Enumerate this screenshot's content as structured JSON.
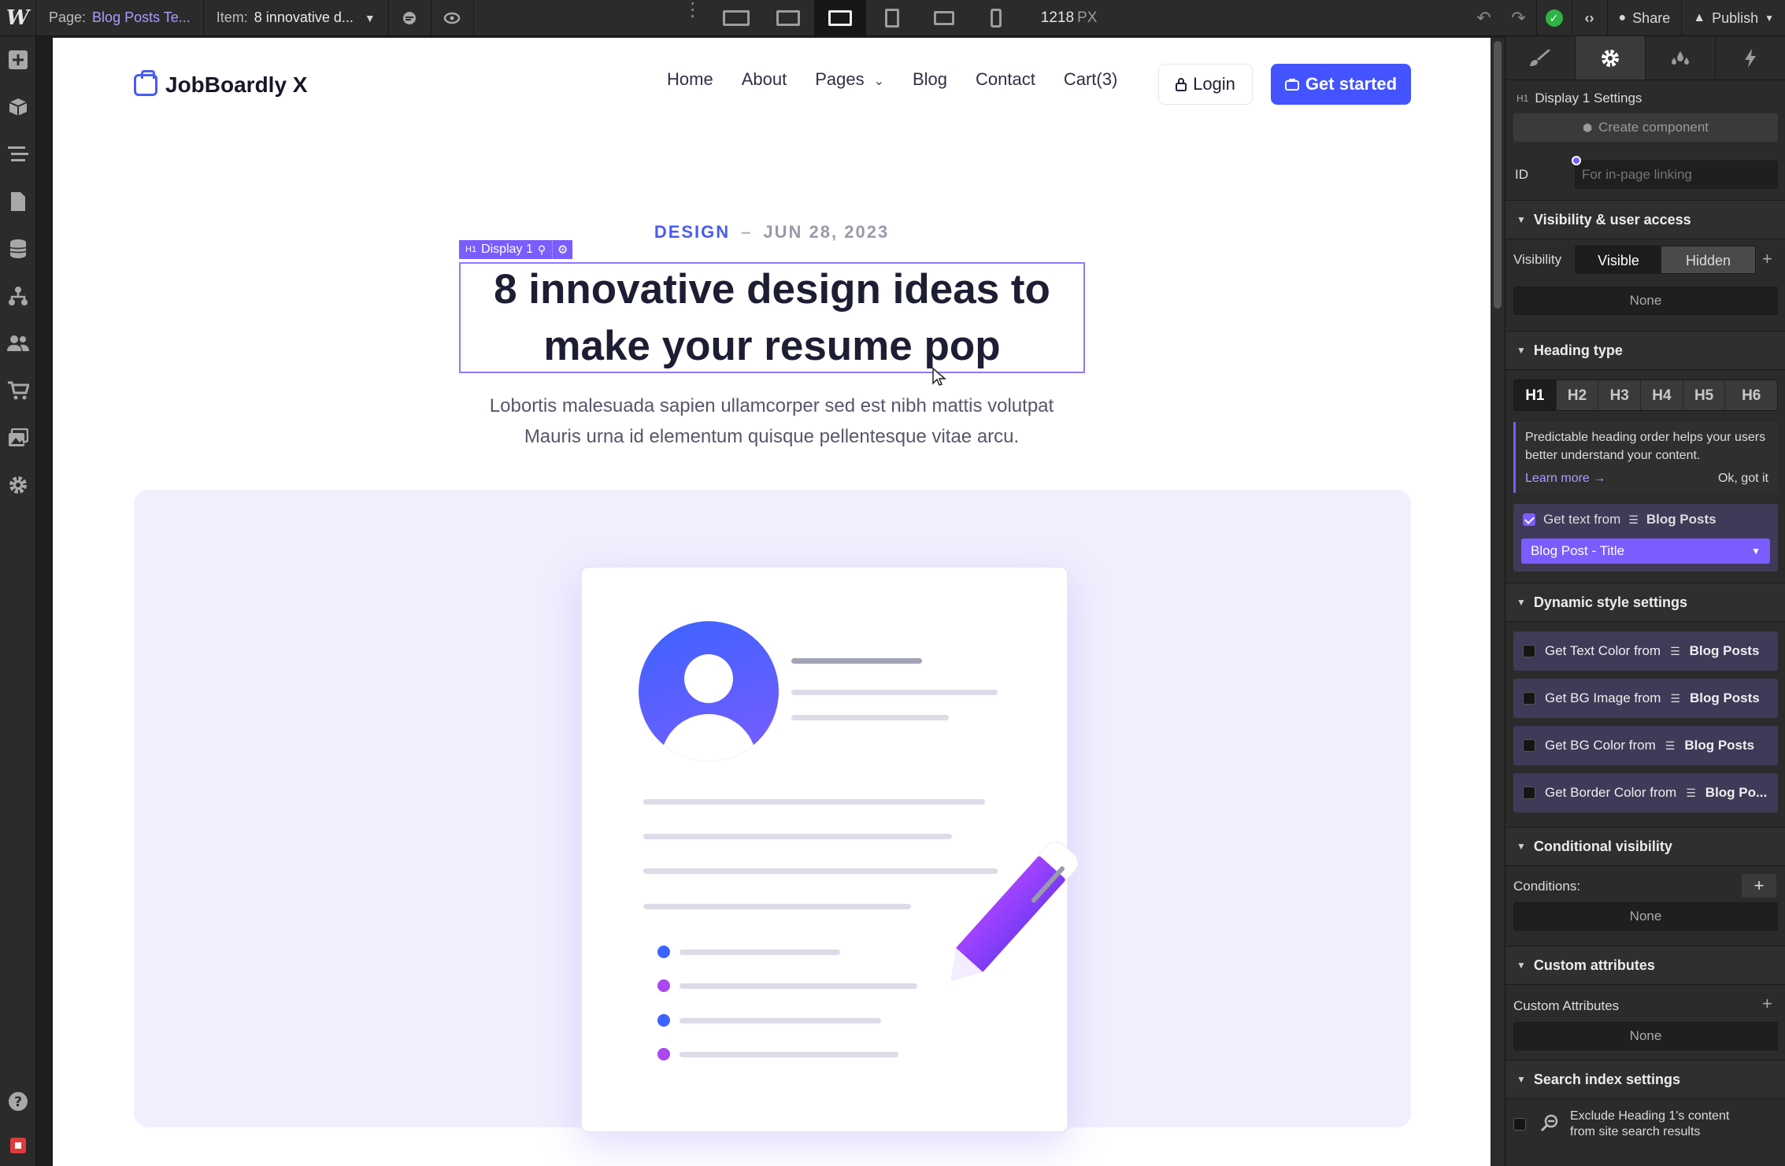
{
  "topbar": {
    "page_label": "Page:",
    "page_value": "Blog Posts Te...",
    "item_label": "Item:",
    "item_value": "8 innovative d...",
    "width_value": "1218",
    "width_unit": "PX",
    "share": "Share",
    "publish": "Publish"
  },
  "site": {
    "brand": "JobBoardly X",
    "nav": [
      "Home",
      "About",
      "Pages",
      "Blog",
      "Contact",
      "Cart(3)"
    ],
    "login": "Login",
    "cta": "Get started",
    "category": "DESIGN",
    "separator": "–",
    "date": "JUN 28, 2023",
    "selection_tag": "Display 1",
    "selection_tag_prefix": "H1",
    "title": "8 innovative design ideas to make your resume pop",
    "lead": "Lobortis malesuada sapien ullamcorper sed est nibh mattis volutpat Mauris urna id elementum quisque pellentesque vitae arcu."
  },
  "panel": {
    "header_prefix": "H1",
    "header": "Display 1 Settings",
    "create_component": "Create component",
    "id_label": "ID",
    "id_placeholder": "For in-page linking",
    "visibility_section": "Visibility & user access",
    "visibility_label": "Visibility",
    "visible": "Visible",
    "hidden": "Hidden",
    "visibility_none": "None",
    "heading_section": "Heading type",
    "headings": [
      "H1",
      "H2",
      "H3",
      "H4",
      "H5",
      "H6"
    ],
    "tip_text": "Predictable heading order helps your users better understand your content.",
    "learn_more": "Learn more →",
    "ok_got_it": "Ok, got it",
    "get_text_from": "Get text from",
    "collection": "Blog Posts",
    "bound_field": "Blog Post - Title",
    "dynamic_section": "Dynamic style settings",
    "dynamic": [
      {
        "label": "Get Text Color from",
        "source": "Blog Posts"
      },
      {
        "label": "Get BG Image from",
        "source": "Blog Posts"
      },
      {
        "label": "Get BG Color from",
        "source": "Blog Posts"
      },
      {
        "label": "Get Border Color from",
        "source": "Blog Po..."
      }
    ],
    "conditional_section": "Conditional visibility",
    "conditions_label": "Conditions:",
    "conditions_none": "None",
    "attributes_section": "Custom attributes",
    "attributes_label": "Custom Attributes",
    "attributes_none": "None",
    "search_section": "Search index settings",
    "exclude_line1": "Exclude Heading 1's content",
    "exclude_line2": "from site search results"
  },
  "colors": {
    "accent": "#4353ff",
    "selection": "#7b5cff",
    "success": "#2fb344"
  }
}
